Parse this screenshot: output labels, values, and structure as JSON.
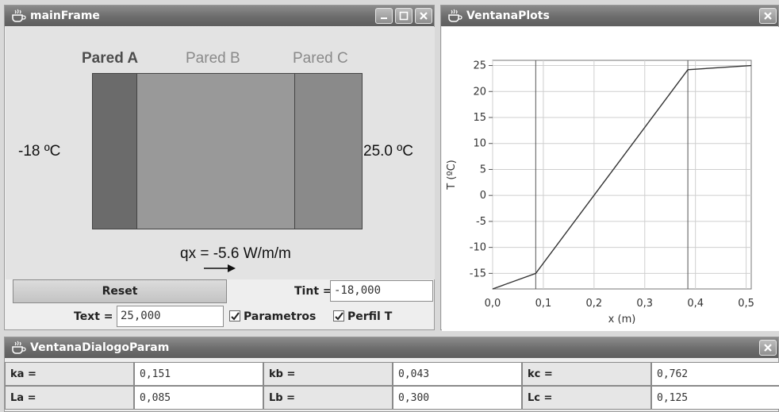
{
  "main_frame": {
    "title": "mainFrame",
    "walls": [
      "Pared A",
      "Pared B",
      "Pared C"
    ],
    "t_left": "-18 ºC",
    "t_right": "25.0 ºC",
    "qx": "qx = -5.6 W/m/m",
    "reset_label": "Reset",
    "tint_label": "Tint =",
    "tint_value": "-18,000",
    "text_label": "Text =",
    "text_value": "25,000",
    "parametros_label": "Parametros",
    "perfil_label": "Perfil T",
    "parametros_checked": true,
    "perfil_checked": true
  },
  "plots_window": {
    "title": "VentanaPlots"
  },
  "chart_data": {
    "type": "line",
    "xlabel": "x (m)",
    "ylabel": "T (ºC)",
    "xlim": [
      0.0,
      0.51
    ],
    "ylim": [
      -18,
      26
    ],
    "x_ticks": [
      "0,0",
      "0,1",
      "0,2",
      "0,3",
      "0,4",
      "0,5"
    ],
    "x_tick_values": [
      0.0,
      0.1,
      0.2,
      0.3,
      0.4,
      0.5
    ],
    "y_ticks": [
      "25",
      "20",
      "15",
      "10",
      "5",
      "0",
      "-5",
      "-10",
      "-15"
    ],
    "y_tick_values": [
      25,
      20,
      15,
      10,
      5,
      0,
      -5,
      -10,
      -15
    ],
    "vertical_lines": [
      0.085,
      0.385
    ],
    "grid": true,
    "series": [
      {
        "x": [
          0.0,
          0.085,
          0.385,
          0.51
        ],
        "y": [
          -18,
          -15.0,
          24.2,
          25.0
        ]
      }
    ]
  },
  "param_dialog": {
    "title": "VentanaDialogoParam",
    "rows": [
      [
        {
          "label": "ka =",
          "value": "0,151"
        },
        {
          "label": "kb =",
          "value": "0,043"
        },
        {
          "label": "kc =",
          "value": "0,762"
        }
      ],
      [
        {
          "label": "La =",
          "value": "0,085"
        },
        {
          "label": "Lb =",
          "value": "0,300"
        },
        {
          "label": "Lc =",
          "value": "0,125"
        }
      ]
    ]
  },
  "colors": {
    "wall_a": "#6b6b6b",
    "wall_b": "#999999",
    "wall_c": "#8a8a8a",
    "titlebar": "#6e6e6e",
    "plot_line": "#333333"
  },
  "icons": [
    "java-cup-icon",
    "minimize-icon",
    "maximize-icon",
    "close-icon",
    "arrow-right-icon",
    "checkbox-check-icon"
  ]
}
